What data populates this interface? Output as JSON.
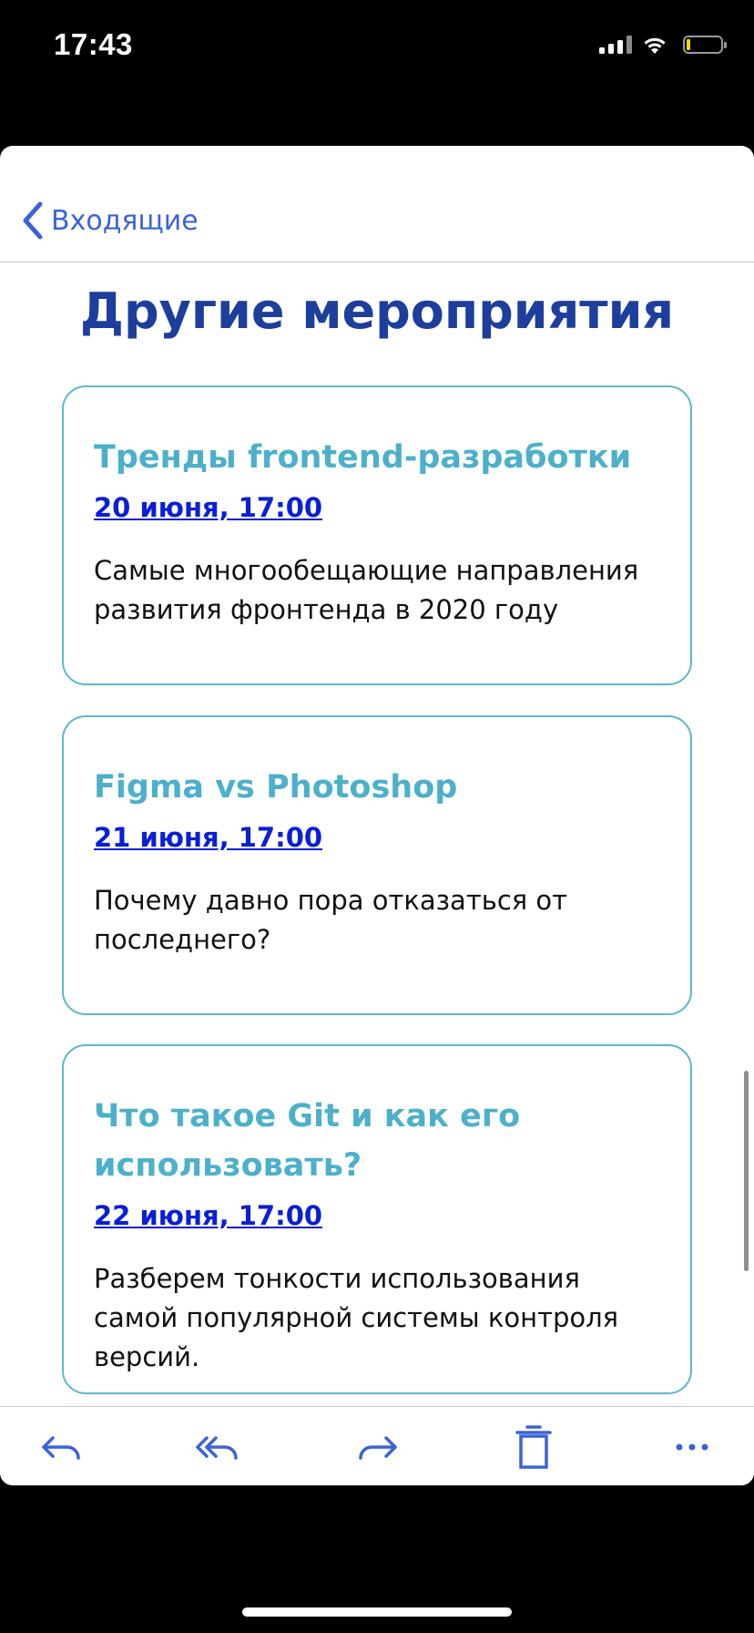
{
  "status_bar": {
    "time": "17:43",
    "icons": [
      "signal-icon",
      "wifi-icon",
      "battery-icon"
    ],
    "battery_color": "#f5d60a"
  },
  "nav": {
    "back_label": "Входящие",
    "back_icon": "chevron-left-icon"
  },
  "content": {
    "title": "Другие мероприятия",
    "events": [
      {
        "title": "Тренды frontend-разработки",
        "date": "20 июня, 17:00",
        "description": "Самые многообещающие направления развития фронтенда в 2020 году"
      },
      {
        "title": "Figma vs Photoshop",
        "date": "21 июня, 17:00",
        "description": "Почему давно пора отказаться от последнего?"
      },
      {
        "title": "Что такое Git и как его использовать?",
        "date": "22 июня, 17:00",
        "description": "Разберем тонкости использования самой популярной системы контроля версий."
      }
    ]
  },
  "toolbar": {
    "items": [
      "reply-icon",
      "reply-all-icon",
      "forward-icon",
      "trash-icon",
      "more-icon"
    ]
  },
  "colors": {
    "accent": "#3b63d8",
    "title": "#1d3e9c",
    "card_border": "#5bb8cc",
    "event_title": "#4db0cb",
    "link": "#0a1fd6"
  }
}
